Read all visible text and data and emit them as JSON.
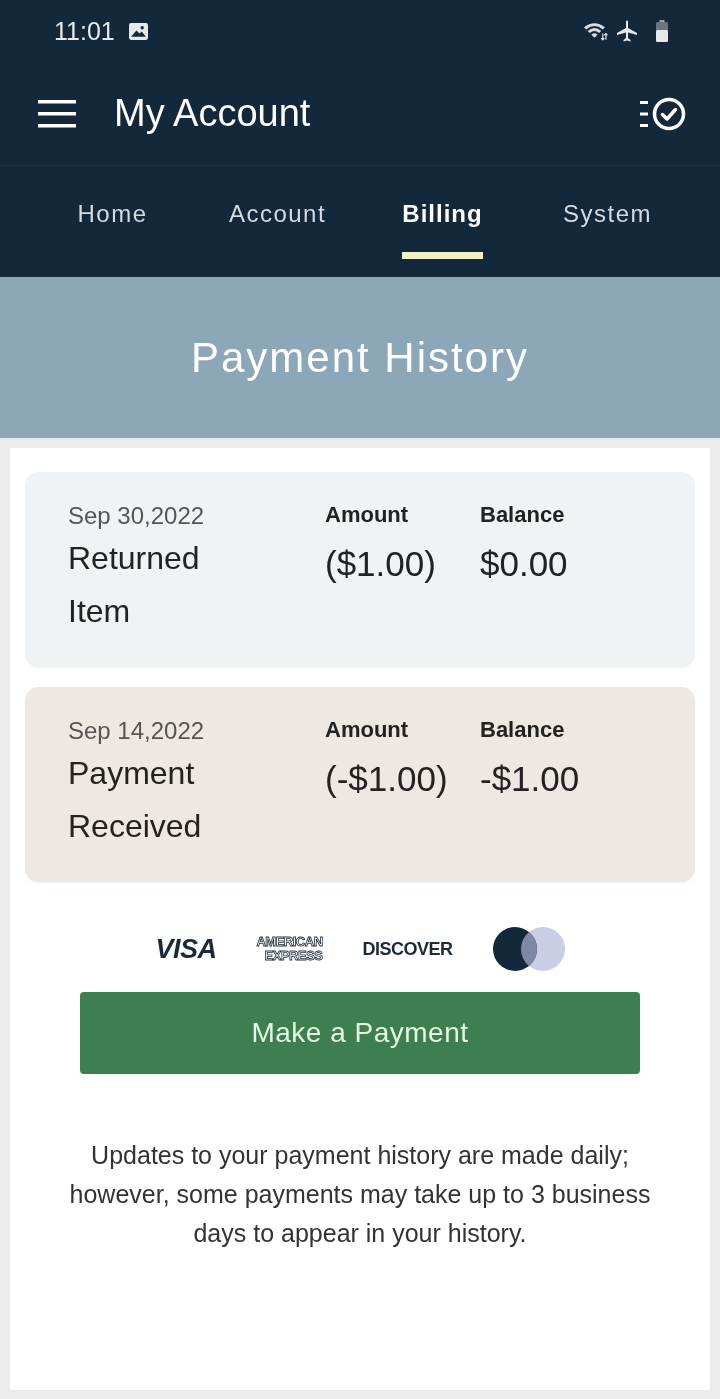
{
  "status_bar": {
    "time": "11:01"
  },
  "app_bar": {
    "title": "My Account"
  },
  "tabs": [
    {
      "label": "Home",
      "selected": false
    },
    {
      "label": "Account",
      "selected": false
    },
    {
      "label": "Billing",
      "selected": true
    },
    {
      "label": "System",
      "selected": false
    }
  ],
  "banner": {
    "title": "Payment History"
  },
  "transactions": [
    {
      "date": "Sep 30,2022",
      "description": "Returned Item",
      "amount_label": "Amount",
      "amount": "($1.00)",
      "balance_label": "Balance",
      "balance": "$0.00",
      "color": "#eff3f6"
    },
    {
      "date": "Sep 14,2022",
      "description": "Payment Received",
      "amount_label": "Amount",
      "amount": "(-$1.00)",
      "balance_label": "Balance",
      "balance": "-$1.00",
      "color": "#ede9e2"
    }
  ],
  "card_brands": [
    {
      "kind": "visa",
      "label": "VISA"
    },
    {
      "kind": "amex",
      "label": "AMERICAN EXPRESS"
    },
    {
      "kind": "discover",
      "label": "DISCOVER"
    },
    {
      "kind": "mastercard"
    }
  ],
  "payment_button": {
    "label": "Make a Payment"
  },
  "note": "Updates to your payment history are made daily; however, some payments may take up to 3 business days to appear in your history."
}
